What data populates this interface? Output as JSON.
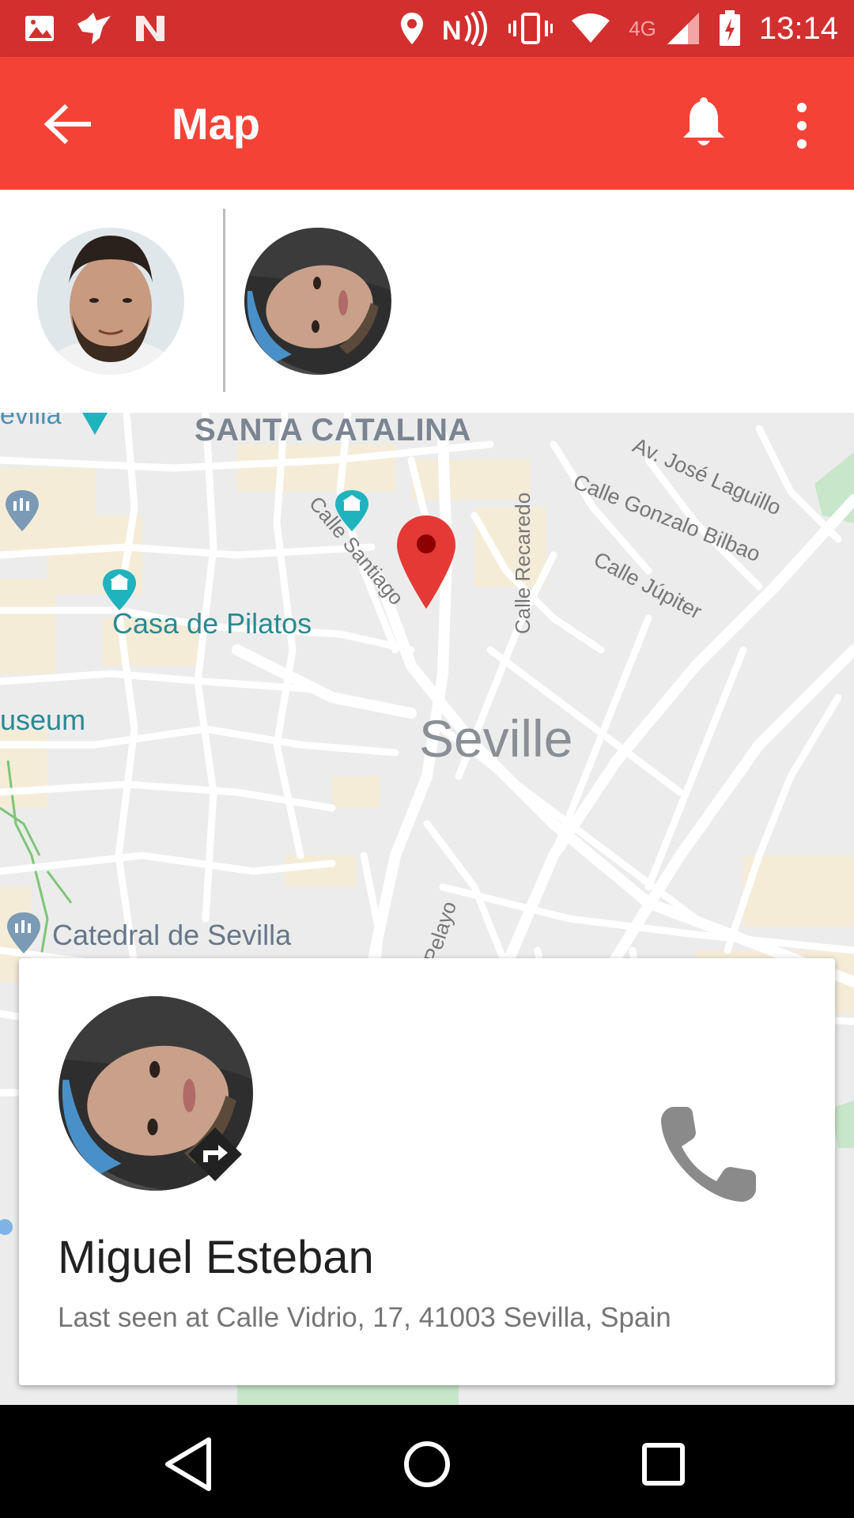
{
  "status_bar": {
    "time": "13:14",
    "network_type": "4G",
    "icons": [
      "image-icon",
      "bird-app-icon",
      "n-app-icon",
      "location-icon",
      "nfc-icon",
      "vibrate-icon",
      "wifi-icon",
      "signal-icon",
      "battery-charging-icon"
    ]
  },
  "app_bar": {
    "title": "Map",
    "back_icon": "arrow-back-icon",
    "notification_icon": "bell-icon",
    "menu_icon": "more-vert-icon"
  },
  "contacts_strip": {
    "avatars": [
      "contact-avatar-1",
      "contact-avatar-2"
    ]
  },
  "map": {
    "labels": {
      "neighborhood": "SANTA CATALINA",
      "city": "Seville",
      "poi_pilatos": "Casa de Pilatos",
      "poi_catedral": "Catedral de Sevilla",
      "poi_museum": "useum",
      "poi_sevilla_top": "evilla",
      "street_santiago": "Calle Santiago",
      "street_recaredo": "Calle Recaredo",
      "street_laguillo": "Av. José Laguillo",
      "street_bilbao": "Calle Gonzalo Bilbao",
      "street_jupiter": "Calle Júpiter",
      "street_pelayo": "Pelayo"
    },
    "marker_color": "#e53935"
  },
  "contact_card": {
    "name": "Miguel Esteban",
    "last_seen": "Last seen at Calle Vidrio, 17, 41003 Sevilla, Spain",
    "call_icon": "phone-icon",
    "directions_icon": "directions-icon"
  },
  "nav_bar": {
    "buttons": [
      "back-triangle-icon",
      "home-circle-icon",
      "recents-square-icon"
    ]
  },
  "colors": {
    "status_bar": "#d32f2f",
    "app_bar": "#f44336",
    "map_background": "#ececec"
  }
}
